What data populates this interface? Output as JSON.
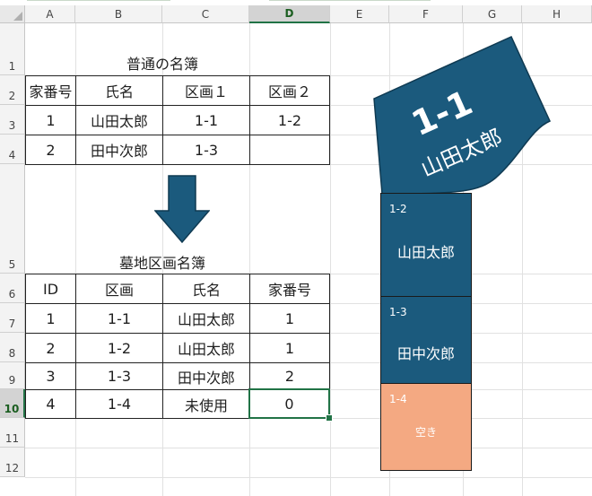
{
  "columns": [
    "A",
    "B",
    "C",
    "D",
    "E",
    "F",
    "G",
    "H"
  ],
  "rows": [
    "1",
    "2",
    "3",
    "4",
    "5",
    "6",
    "7",
    "8",
    "9",
    "10",
    "11",
    "12"
  ],
  "active_column": "D",
  "active_row": "10",
  "colors": {
    "plot_fill": "#1b5a7d",
    "empty_plot_fill": "#f4a982",
    "selection": "#217346"
  },
  "table1": {
    "title": "普通の名簿",
    "headers": [
      "家番号",
      "氏名",
      "区画１",
      "区画２"
    ],
    "rows": [
      [
        "1",
        "山田太郎",
        "1-1",
        "1-2"
      ],
      [
        "2",
        "田中次郎",
        "1-3",
        ""
      ]
    ]
  },
  "arrow_icon": "down-arrow-icon",
  "table2": {
    "title": "墓地区画名簿",
    "headers": [
      "ID",
      "区画",
      "氏名",
      "家番号"
    ],
    "rows": [
      [
        "1",
        "1-1",
        "山田太郎",
        "1"
      ],
      [
        "2",
        "1-2",
        "山田太郎",
        "1"
      ],
      [
        "3",
        "1-3",
        "田中次郎",
        "2"
      ],
      [
        "4",
        "1-4",
        "未使用",
        "0"
      ]
    ]
  },
  "plots": {
    "plot1": {
      "code": "1-1",
      "name": "山田太郎"
    },
    "plot2": {
      "code": "1-2",
      "name": "山田太郎"
    },
    "plot3": {
      "code": "1-3",
      "name": "田中次郎"
    },
    "plot4": {
      "code": "1-4",
      "name": "空き"
    }
  }
}
